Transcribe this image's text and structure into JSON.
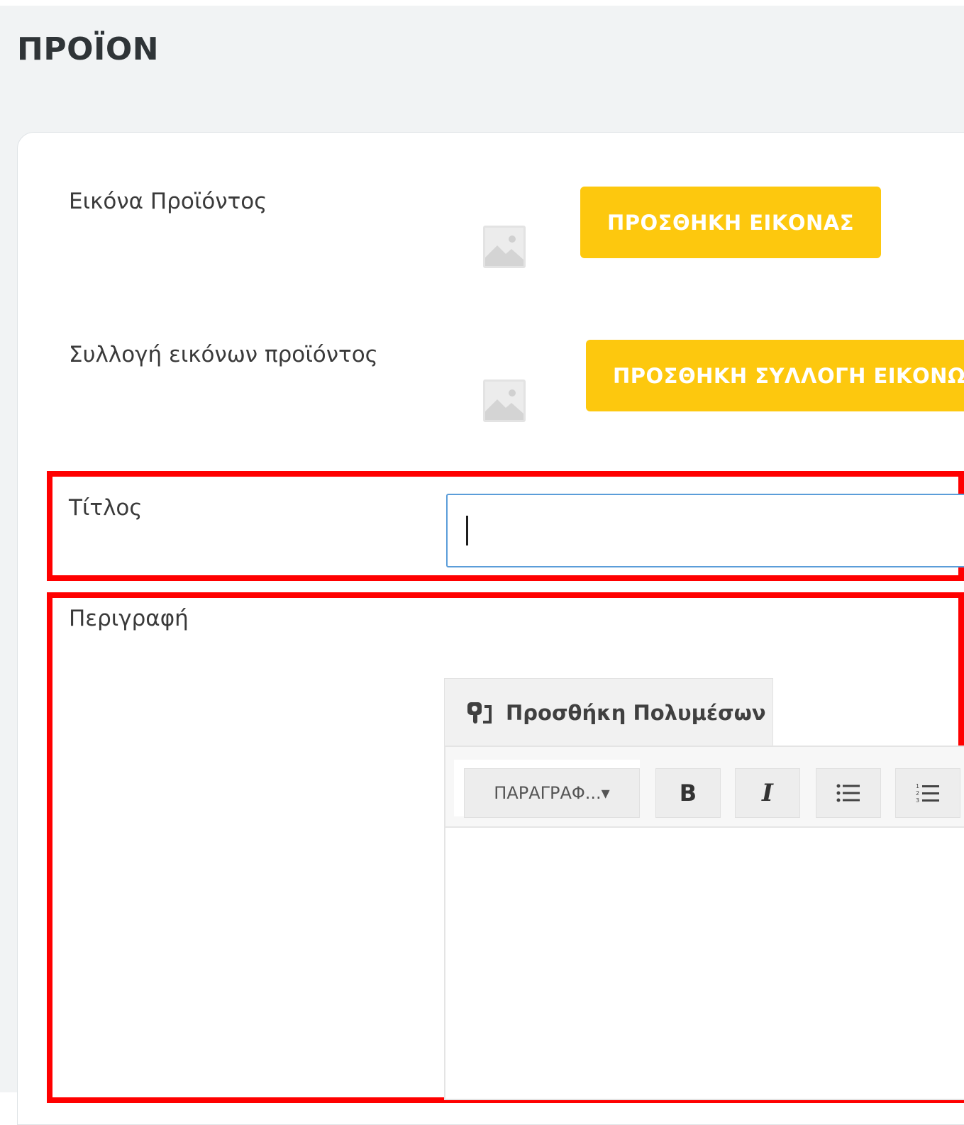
{
  "page": {
    "title": "ΠΡΟΪΟΝ"
  },
  "product_image": {
    "label": "Εικόνα Προϊόντος",
    "button_label": "ΠΡΟΣΘΗΚΗ ΕΙΚΟΝΑΣ",
    "placeholder_icon": "image-placeholder-icon"
  },
  "gallery": {
    "label": "Συλλογή εικόνων προϊόντος",
    "button_label": "ΠΡΟΣΘΗΚΗ ΣΥΛΛΟΓΗ ΕΙΚΟΝΩΝ",
    "placeholder_icon": "image-placeholder-icon"
  },
  "title_field": {
    "label": "Τίτλος",
    "value": "",
    "focused": true
  },
  "description": {
    "label": "Περιγραφή",
    "media_button_label": "Προσθήκη Πολυμέσων",
    "media_icon": "add-media-icon",
    "toolbar": {
      "format_select": "ΠΑΡΑΓΡΑΦ...▾",
      "bold_label": "B",
      "italic_label": "I",
      "bullet_list_icon": "bullet-list-icon",
      "numbered_list_icon": "numbered-list-icon"
    },
    "content": ""
  },
  "colors": {
    "accent_button": "#fdc80e",
    "highlight_box": "#ff0000",
    "focus_border": "#5b9dd9"
  }
}
